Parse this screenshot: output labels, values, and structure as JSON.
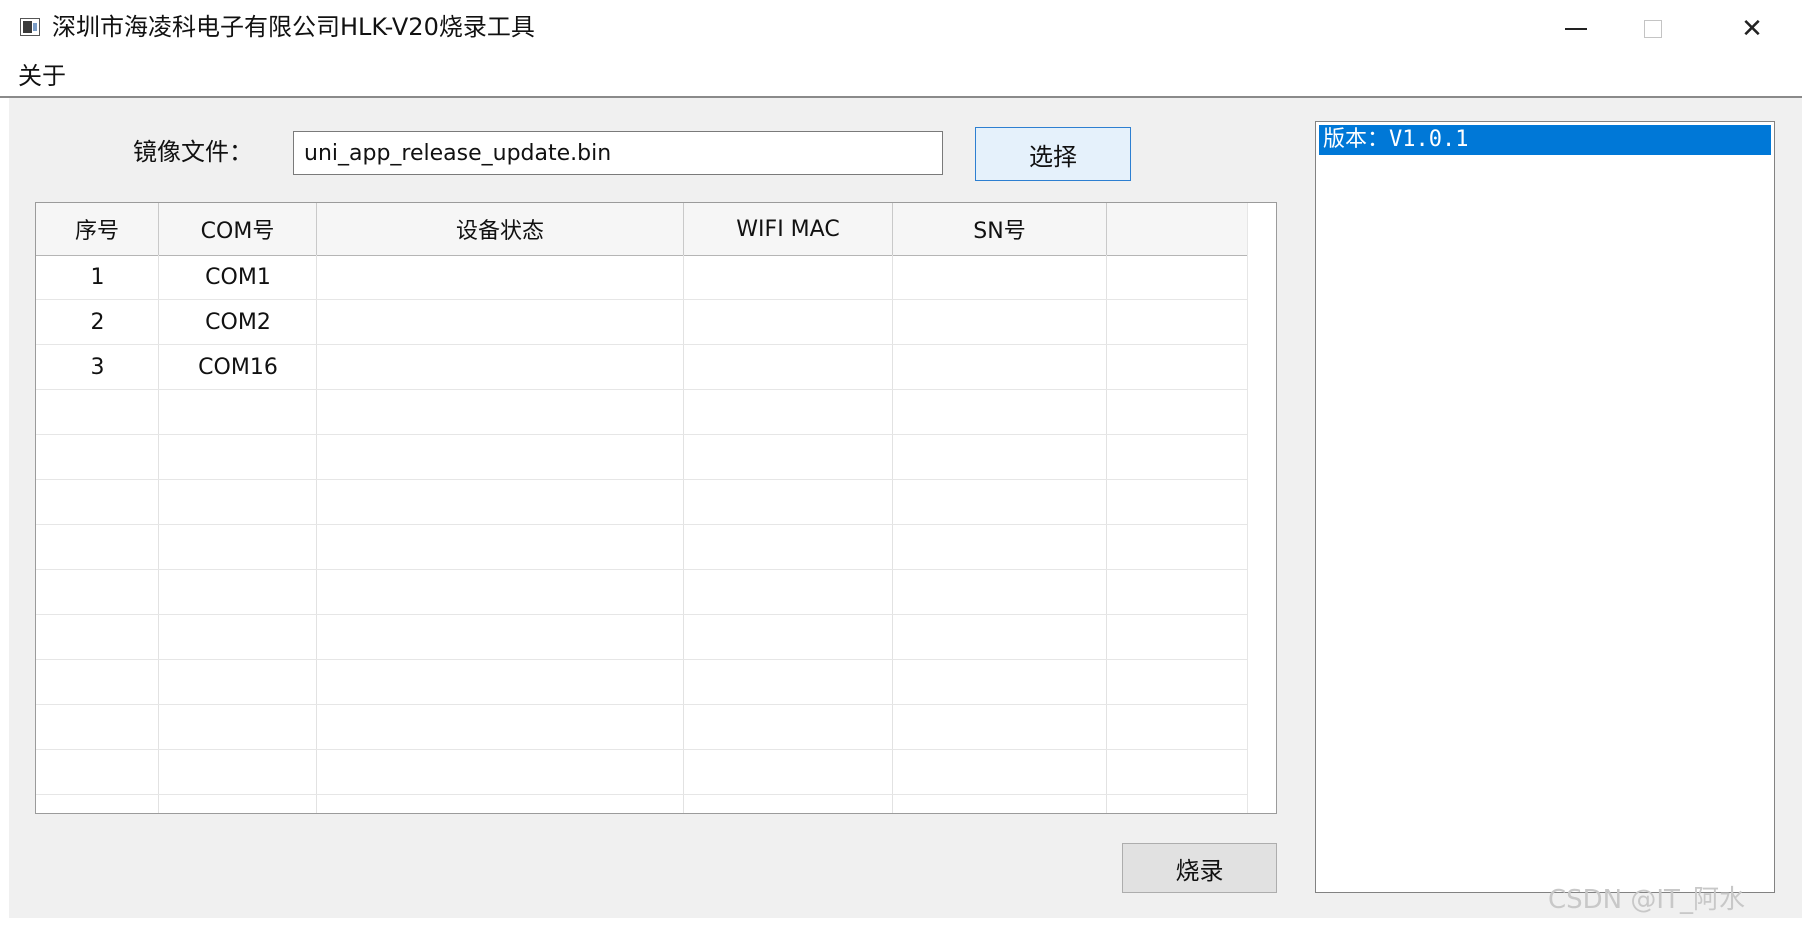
{
  "window": {
    "title": "深圳市海凌科电子有限公司HLK-V20烧录工具",
    "controls": {
      "minimize": "minimize",
      "maximize": "maximize",
      "close": "✕"
    }
  },
  "menu": {
    "items": [
      {
        "label": "关于"
      }
    ]
  },
  "image_file": {
    "label": "镜像文件：",
    "value": "uni_app_release_update.bin",
    "select_label": "选择"
  },
  "table": {
    "columns": [
      "序号",
      "COM号",
      "设备状态",
      "WIFI MAC",
      "SN号"
    ],
    "rows": [
      {
        "index": "1",
        "com": "COM1",
        "status": "",
        "mac": "",
        "sn": ""
      },
      {
        "index": "2",
        "com": "COM2",
        "status": "",
        "mac": "",
        "sn": ""
      },
      {
        "index": "3",
        "com": "COM16",
        "status": "",
        "mac": "",
        "sn": ""
      }
    ]
  },
  "log": {
    "items": [
      "版本：V1.0.1"
    ]
  },
  "burn_label": "烧录",
  "watermark": "CSDN @IT_阿水",
  "colors": {
    "selection": "#0078d7",
    "button_focus_bg": "#e5f1fb",
    "client_bg": "#f0f0f0"
  }
}
